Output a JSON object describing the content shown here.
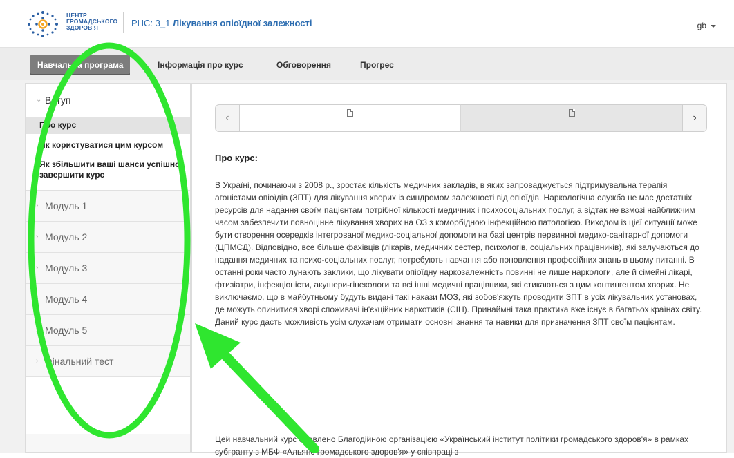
{
  "header": {
    "org_line1": "ЦЕНТР",
    "org_line2": "ГРОМАДСЬКОГО",
    "org_line3": "ЗДОРОВ'Я",
    "course_code": "PHC: 3_1",
    "course_name": "Лікування опіоїдної залежності",
    "language": "gb"
  },
  "tabs": [
    {
      "label": "Навчальна програма"
    },
    {
      "label": "Інформація про курс"
    },
    {
      "label": "Обговорення"
    },
    {
      "label": "Прогрес"
    }
  ],
  "sidebar": {
    "open_section": {
      "title": "Вступ",
      "items": [
        {
          "label": "Про курс"
        },
        {
          "label": "Як користуватися цим курсом"
        },
        {
          "label": "Як збільшити ваші шанси успішно завершити курс"
        }
      ]
    },
    "sections": [
      {
        "title": "Модуль 1"
      },
      {
        "title": "Модуль 2"
      },
      {
        "title": "Модуль 3"
      },
      {
        "title": "Модуль 4"
      },
      {
        "title": "Модуль 5"
      },
      {
        "title": "Фінальний тест"
      }
    ]
  },
  "content": {
    "heading": "Про курс:",
    "paragraph1": "В Україні, починаючи з 2008 р., зростає кількість медичних закладів, в яких запроваджується підтримувальна терапія агоністами опіоїдів (ЗПТ) для лікування хворих із синдромом залежності від опіоїдів. Наркологічна служба не має достатніх ресурсів для надання своїм пацієнтам потрібної кількості медичних і психосоціальних послуг, а відтак не взмозі найближчим часом забезпечити повноцінне лікування хворих на ОЗ з коморбідною інфекційною патологією. Виходом із цієї ситуації може бути створення осередків інтегрованої медико-соціальної допомоги на базі центрів первинної медико-санітарної допомоги (ЦПМСД). Відповідно, все більше фахівців (лікарів, медичних сестер, психологів, соціальних працівників), які залучаються до надання медичних та психо-соціальних послуг, потребують навчання або поновлення професійних знань в цьому питанні. В останні роки часто лунають заклики, що лікувати опіоїдну наркозалежність повинні не лише наркологи, але й сімейні лікарі, фтизіатри, інфекціоністи, акушери-гінекологи та всі інші медичні працівники, які стикаються з цим контингентом хворих. Не виключаємо, що в майбутньому будуть видані такі накази МОЗ, які зобов'яжуть проводити ЗПТ в усіх лікувальних установах, де можуть опинитися хворі споживачі ін'єкційних наркотиків (СІН). Принаймні така практика вже існує в багатьох країнах світу. Даний курс дасть можливість усім слухачам отримати основні знання та навики для призначення ЗПТ своїм пацієнтам.",
    "paragraph2": "Цей навчальний курс оновлено Благодійною організацією «Український інститут політики громадського здоров'я» в рамках субгранту з МБФ «Альянс громадського здоров'я» у співпраці з"
  },
  "colors": {
    "annotation": "#2fe62f",
    "link_blue": "#2b6cb0",
    "active_tab": "#7d7d7d"
  },
  "icons": {
    "prev": "chevron-left-icon",
    "next": "chevron-right-icon",
    "unit": "document-icon",
    "lang_caret": "caret-down-icon"
  }
}
